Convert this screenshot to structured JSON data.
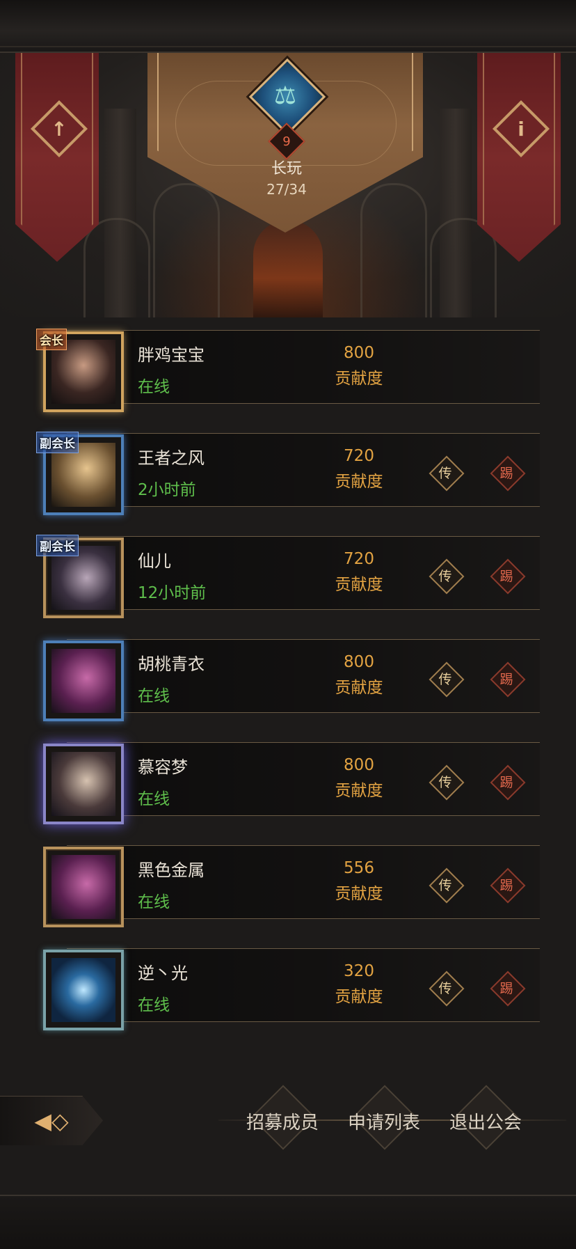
{
  "guild": {
    "level": "9",
    "name": "长玩",
    "member_count": "27/34",
    "emblem_icon": "scales-figure-icon"
  },
  "colors": {
    "online": "#5fbf4c",
    "offline": "#5fbf4c",
    "contribution": "#e3a342",
    "kick": "#e0674c"
  },
  "members": [
    {
      "name": "胖鸡宝宝",
      "status": "在线",
      "contribution": "800",
      "contribution_label": "贡献度",
      "role": "会长",
      "frame": "gold",
      "actions": false
    },
    {
      "name": "王者之风",
      "status": "2小时前",
      "contribution": "720",
      "contribution_label": "贡献度",
      "role": "副会长",
      "frame": "blue",
      "actions": true
    },
    {
      "name": "仙儿",
      "status": "12小时前",
      "contribution": "720",
      "contribution_label": "贡献度",
      "role": "副会长",
      "frame": "plain",
      "actions": true
    },
    {
      "name": "胡桃青衣",
      "status": "在线",
      "contribution": "800",
      "contribution_label": "贡献度",
      "role": "",
      "frame": "blue",
      "actions": true
    },
    {
      "name": "慕容梦",
      "status": "在线",
      "contribution": "800",
      "contribution_label": "贡献度",
      "role": "",
      "frame": "purple",
      "actions": true
    },
    {
      "name": "黑色金属",
      "status": "在线",
      "contribution": "556",
      "contribution_label": "贡献度",
      "role": "",
      "frame": "plain",
      "actions": true
    },
    {
      "name": "逆丶光",
      "status": "在线",
      "contribution": "320",
      "contribution_label": "贡献度",
      "role": "",
      "frame": "teal",
      "actions": true
    }
  ],
  "actions": {
    "transfer": "传",
    "kick": "踢"
  },
  "bottom": {
    "recruit": "招募成员",
    "applications": "申请列表",
    "leave": "退出公会",
    "back_icon": "back-arrow-icon"
  }
}
